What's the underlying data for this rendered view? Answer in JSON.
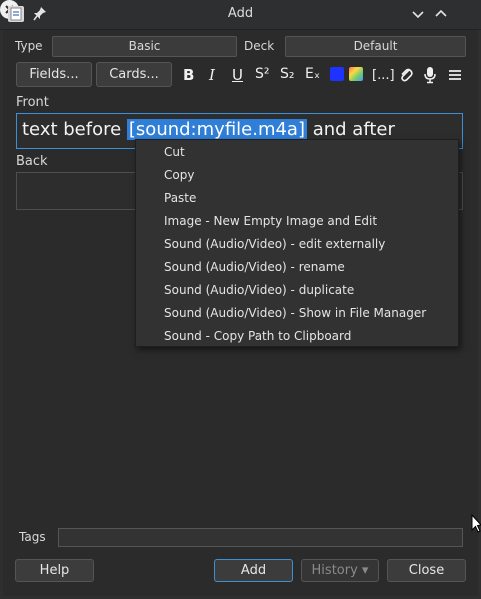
{
  "window": {
    "title": "Add"
  },
  "top": {
    "type_label": "Type",
    "type_value": "Basic",
    "deck_label": "Deck",
    "deck_value": "Default"
  },
  "toolbar": {
    "fields_button": "Fields...",
    "cards_button": "Cards...",
    "bold": "B",
    "italic": "I",
    "underline": "U",
    "superscript": "S²",
    "subscript": "S₂",
    "clear_format": "Eₓ",
    "cloze": "[...]",
    "colors": {
      "text_color": "#1e33ff"
    }
  },
  "fields": {
    "front_label": "Front",
    "front_before": "text before ",
    "front_selected": "[sound:myfile.m4a]",
    "front_after": " and after",
    "back_label": "Back"
  },
  "context_menu": {
    "items": [
      "Cut",
      "Copy",
      "Paste",
      "Image - New Empty Image and Edit",
      "Sound (Audio/Video) - edit externally",
      "Sound (Audio/Video) - rename",
      "Sound (Audio/Video) - duplicate",
      "Sound (Audio/Video) - Show in File Manager",
      "Sound - Copy Path to Clipboard"
    ]
  },
  "tags": {
    "label": "Tags",
    "value": ""
  },
  "bottom": {
    "help": "Help",
    "add": "Add",
    "history": "History ▾",
    "close": "Close"
  }
}
